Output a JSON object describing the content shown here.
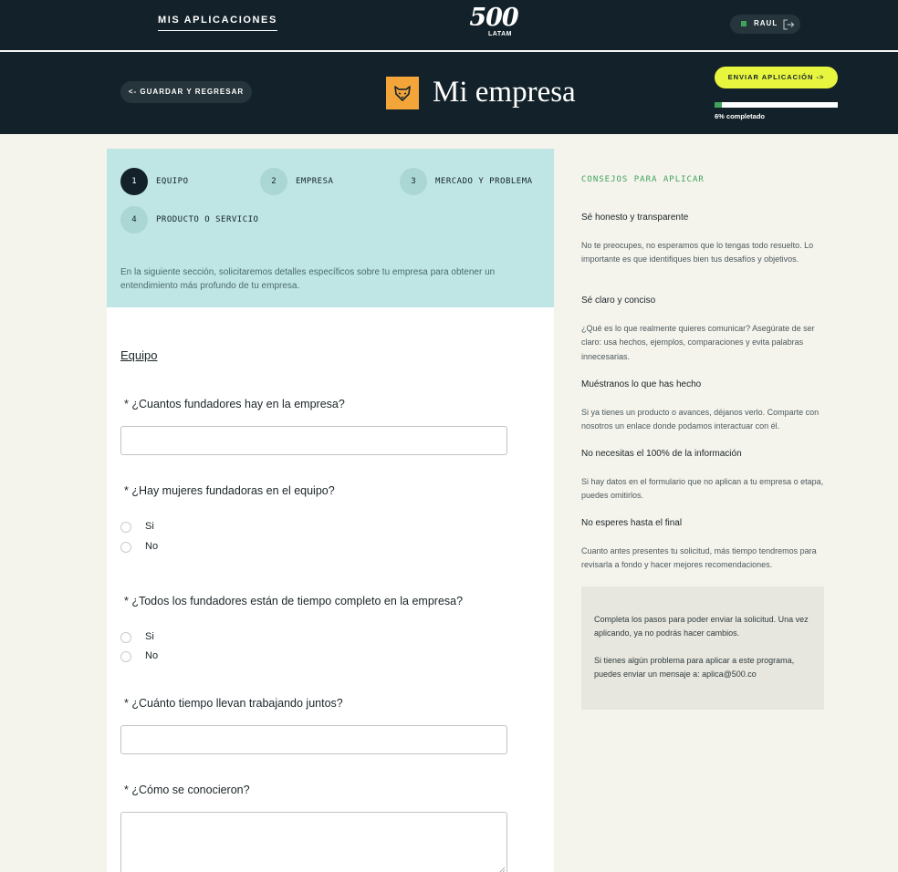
{
  "topbar": {
    "nav_link": "MIS APLICACIONES",
    "logo_number": "500",
    "logo_sub": "LATAM",
    "user_name": "RAUL"
  },
  "header": {
    "back_button": "<- GUARDAR Y REGRESAR",
    "title": "Mi empresa",
    "send_button": "ENVIAR APLICACIÓN ->",
    "progress_percent": 6,
    "progress_label": "6% completado"
  },
  "steps": {
    "items": [
      {
        "number": "1",
        "label": "EQUIPO",
        "active": true
      },
      {
        "number": "2",
        "label": "EMPRESA",
        "active": false
      },
      {
        "number": "3",
        "label": "MERCADO Y PROBLEMA",
        "active": false
      },
      {
        "number": "4",
        "label": "PRODUCTO O SERVICIO",
        "active": false
      }
    ],
    "description": "En la siguiente sección, solicitaremos detalles específicos sobre tu empresa para obtener un entendimiento más profundo de tu empresa."
  },
  "form": {
    "section_title": "Equipo",
    "questions": [
      {
        "label": "* ¿Cuantos fundadores hay en la empresa?",
        "type": "text",
        "value": ""
      },
      {
        "label": "* ¿Hay mujeres fundadoras en el equipo?",
        "type": "radio",
        "options": [
          "Si",
          "No"
        ]
      },
      {
        "label": "* ¿Todos los fundadores están de tiempo completo en la empresa?",
        "type": "radio",
        "options": [
          "Si",
          "No"
        ]
      },
      {
        "label": "* ¿Cuánto tiempo llevan trabajando juntos?",
        "type": "text",
        "value": ""
      },
      {
        "label": "* ¿Cómo se conocieron?",
        "type": "textarea",
        "value": ""
      }
    ]
  },
  "tips": {
    "title": "CONSEJOS PARA APLICAR",
    "items": [
      {
        "heading": "Sé honesto y transparente",
        "text": "No te preocupes, no esperamos que lo tengas todo resuelto. Lo importante es que identifiques bien tus desafíos y objetivos."
      },
      {
        "heading": "Sé claro y conciso",
        "text": "¿Qué es lo que realmente quieres comunicar? Asegúrate de ser claro: usa hechos, ejemplos, comparaciones y evita palabras innecesarias."
      },
      {
        "heading": "Muéstranos lo que has hecho",
        "text": "Si ya tienes un producto o avances, déjanos verlo. Comparte con nosotros un enlace donde podamos interactuar con él."
      },
      {
        "heading": "No necesitas el 100% de la información",
        "text": "Si hay datos en el formulario que no aplican a tu empresa o etapa, puedes omitirlos."
      },
      {
        "heading": "No esperes hasta el final",
        "text": "Cuanto antes presentes tu solicitud, más tiempo tendremos para revisarla a fondo y hacer mejores recomendaciones."
      }
    ],
    "note": [
      "Completa los pasos para poder enviar la solicitud. Una vez aplicando, ya no podrás hacer cambios.",
      "Si tienes algún problema para aplicar a este programa, puedes enviar un mensaje a: aplica@500.co"
    ]
  },
  "colors": {
    "dark": "#13222a",
    "accent_yellow": "#e7f53e",
    "accent_green": "#3fa35b",
    "steps_bg": "#bfe6e4",
    "page_bg": "#f4f3ec",
    "company_logo_bg": "#f3a53a"
  }
}
